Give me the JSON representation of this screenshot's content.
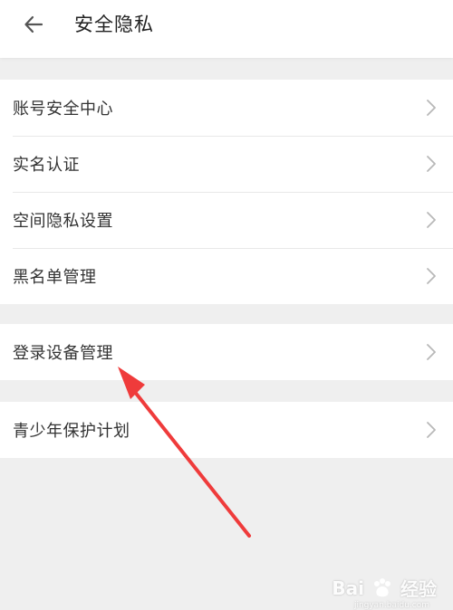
{
  "header": {
    "title": "安全隐私",
    "back_icon": "arrow-left-icon"
  },
  "groups": [
    {
      "items": [
        {
          "label": "账号安全中心",
          "icon": "chevron-right-icon"
        },
        {
          "label": "实名认证",
          "icon": "chevron-right-icon"
        },
        {
          "label": "空间隐私设置",
          "icon": "chevron-right-icon"
        },
        {
          "label": "黑名单管理",
          "icon": "chevron-right-icon"
        }
      ]
    },
    {
      "items": [
        {
          "label": "登录设备管理",
          "icon": "chevron-right-icon"
        }
      ]
    },
    {
      "items": [
        {
          "label": "青少年保护计划",
          "icon": "chevron-right-icon"
        }
      ]
    }
  ],
  "annotation": {
    "arrow_color": "#ef3b3b"
  },
  "watermark": {
    "brand_left": "Bai",
    "brand_right": "经验",
    "sub": "jingyan.baidu.com"
  },
  "colors": {
    "background": "#efefef",
    "surface": "#ffffff",
    "text": "#333333",
    "divider": "#e8e8e8",
    "chevron": "#b8b8b8"
  }
}
